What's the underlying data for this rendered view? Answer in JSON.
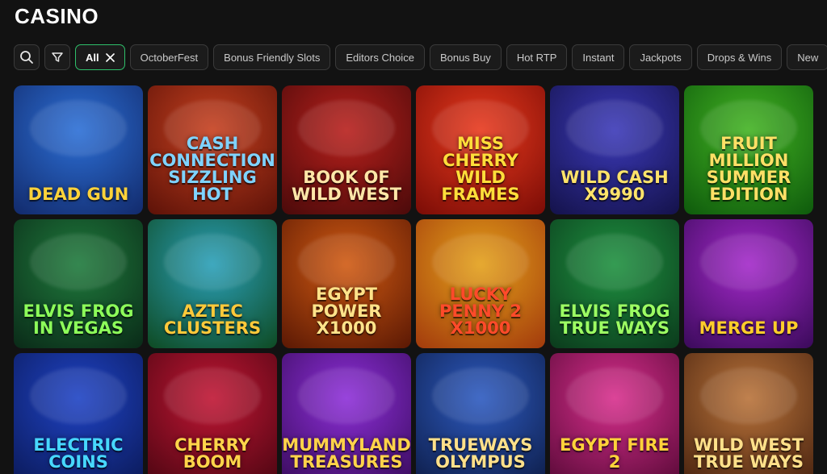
{
  "page": {
    "title": "CASINO"
  },
  "filters": {
    "search_icon": "search-icon",
    "filter_icon": "filter-icon",
    "chips": [
      {
        "label": "All",
        "active": true
      },
      {
        "label": "OctoberFest",
        "active": false
      },
      {
        "label": "Bonus Friendly Slots",
        "active": false
      },
      {
        "label": "Editors Choice",
        "active": false
      },
      {
        "label": "Bonus Buy",
        "active": false
      },
      {
        "label": "Hot RTP",
        "active": false
      },
      {
        "label": "Instant",
        "active": false
      },
      {
        "label": "Jackpots",
        "active": false
      },
      {
        "label": "Drops & Wins",
        "active": false
      },
      {
        "label": "New",
        "active": false
      }
    ]
  },
  "games": [
    {
      "name": "Dead Gun",
      "bg": "#2c6fd6",
      "bg2": "#122a6b",
      "text": "#ffd23a"
    },
    {
      "name": "Cash Connection Sizzling Hot",
      "bg": "#c6401f",
      "bg2": "#5c1208",
      "text": "#7fd3ff"
    },
    {
      "name": "Book of Wild West",
      "bg": "#b8201c",
      "bg2": "#4a0a0a",
      "text": "#ffe6a8"
    },
    {
      "name": "Miss Cherry Wild Frames",
      "bg": "#e8391d",
      "bg2": "#7a0c06",
      "text": "#ffde3a"
    },
    {
      "name": "Wild Cash x9990",
      "bg": "#3b39b8",
      "bg2": "#14124a",
      "text": "#ffe36a"
    },
    {
      "name": "Fruit Million Summer Edition",
      "bg": "#43b323",
      "bg2": "#0e5a0c",
      "text": "#ffe066"
    },
    {
      "name": "Elvis Frog in Vegas",
      "bg": "#1f7a3c",
      "bg2": "#0a2a18",
      "text": "#8dff5a"
    },
    {
      "name": "Aztec Clusters",
      "bg": "#2a9fb8",
      "bg2": "#0e4a22",
      "text": "#ffc93a"
    },
    {
      "name": "Egypt Power x1000",
      "bg": "#d05a12",
      "bg2": "#5a1804",
      "text": "#ffe38a"
    },
    {
      "name": "Lucky Penny 2 x1000",
      "bg": "#e3a01a",
      "bg2": "#a23a0c",
      "text": "#ff4a2a"
    },
    {
      "name": "Elvis Frog True Ways",
      "bg": "#1e9140",
      "bg2": "#0b3a1c",
      "text": "#9dff63"
    },
    {
      "name": "Merge Up",
      "bg": "#a329c9",
      "bg2": "#3a0a5a",
      "text": "#ffcd2a"
    },
    {
      "name": "Electric Coins",
      "bg": "#1f43c4",
      "bg2": "#0b1a5a",
      "text": "#47d8ff"
    },
    {
      "name": "Cherry Boom",
      "bg": "#c01634",
      "bg2": "#4e0612",
      "text": "#ffd54a"
    },
    {
      "name": "Mummyland Treasures",
      "bg": "#8d2fd8",
      "bg2": "#3a0c5e",
      "text": "#ffd34a"
    },
    {
      "name": "Trueways Olympus",
      "bg": "#2d5ac0",
      "bg2": "#0e1e4a",
      "text": "#ffe08a"
    },
    {
      "name": "Egypt Fire 2",
      "bg": "#d82f8d",
      "bg2": "#5a0a38",
      "text": "#ffd33a"
    },
    {
      "name": "Wild West True Ways",
      "bg": "#b9733a",
      "bg2": "#4a2410",
      "text": "#ffe08a"
    }
  ],
  "colors": {
    "background": "#121212",
    "chip_border": "#3a3a3a",
    "chip_active_border": "#2fc06a"
  }
}
